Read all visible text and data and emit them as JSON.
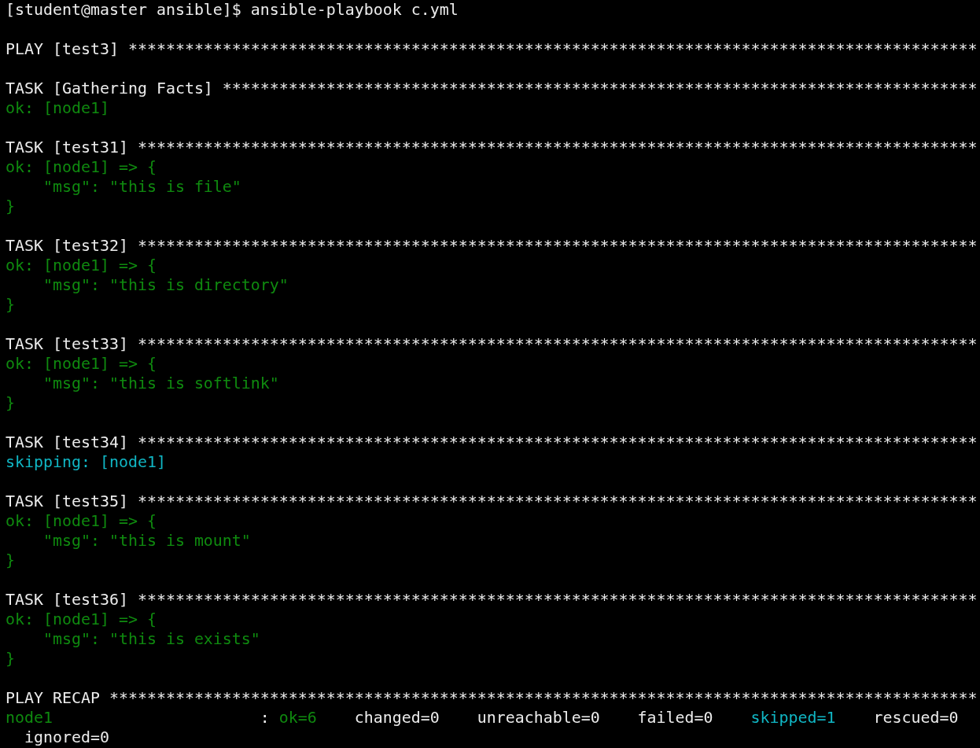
{
  "terminal": {
    "lines": [
      {
        "kind": "text",
        "segments": [
          {
            "kind": "plain",
            "text": "[student@master ansible]$ ansible-playbook c.yml"
          }
        ]
      },
      {
        "kind": "blank"
      },
      {
        "kind": "text",
        "segments": [
          {
            "kind": "plain",
            "text": "PLAY [test3] ******************************************************************************************"
          }
        ]
      },
      {
        "kind": "blank"
      },
      {
        "kind": "text",
        "segments": [
          {
            "kind": "plain",
            "text": "TASK [Gathering Facts] ********************************************************************************"
          }
        ]
      },
      {
        "kind": "text",
        "segments": [
          {
            "kind": "ok",
            "text": "ok: [node1]"
          }
        ]
      },
      {
        "kind": "blank"
      },
      {
        "kind": "text",
        "segments": [
          {
            "kind": "plain",
            "text": "TASK [test31] *****************************************************************************************"
          }
        ]
      },
      {
        "kind": "text",
        "segments": [
          {
            "kind": "ok",
            "text": "ok: [node1] => {"
          }
        ]
      },
      {
        "kind": "text",
        "segments": [
          {
            "kind": "ok",
            "text": "    \"msg\": \"this is file\""
          }
        ]
      },
      {
        "kind": "text",
        "segments": [
          {
            "kind": "ok",
            "text": "}"
          }
        ]
      },
      {
        "kind": "blank"
      },
      {
        "kind": "text",
        "segments": [
          {
            "kind": "plain",
            "text": "TASK [test32] *****************************************************************************************"
          }
        ]
      },
      {
        "kind": "text",
        "segments": [
          {
            "kind": "ok",
            "text": "ok: [node1] => {"
          }
        ]
      },
      {
        "kind": "text",
        "segments": [
          {
            "kind": "ok",
            "text": "    \"msg\": \"this is directory\""
          }
        ]
      },
      {
        "kind": "text",
        "segments": [
          {
            "kind": "ok",
            "text": "}"
          }
        ]
      },
      {
        "kind": "blank"
      },
      {
        "kind": "text",
        "segments": [
          {
            "kind": "plain",
            "text": "TASK [test33] *****************************************************************************************"
          }
        ]
      },
      {
        "kind": "text",
        "segments": [
          {
            "kind": "ok",
            "text": "ok: [node1] => {"
          }
        ]
      },
      {
        "kind": "text",
        "segments": [
          {
            "kind": "ok",
            "text": "    \"msg\": \"this is softlink\""
          }
        ]
      },
      {
        "kind": "text",
        "segments": [
          {
            "kind": "ok",
            "text": "}"
          }
        ]
      },
      {
        "kind": "blank"
      },
      {
        "kind": "text",
        "segments": [
          {
            "kind": "plain",
            "text": "TASK [test34] *****************************************************************************************"
          }
        ]
      },
      {
        "kind": "text",
        "segments": [
          {
            "kind": "skipped",
            "text": "skipping: [node1]"
          }
        ]
      },
      {
        "kind": "blank"
      },
      {
        "kind": "text",
        "segments": [
          {
            "kind": "plain",
            "text": "TASK [test35] *****************************************************************************************"
          }
        ]
      },
      {
        "kind": "text",
        "segments": [
          {
            "kind": "ok",
            "text": "ok: [node1] => {"
          }
        ]
      },
      {
        "kind": "text",
        "segments": [
          {
            "kind": "ok",
            "text": "    \"msg\": \"this is mount\""
          }
        ]
      },
      {
        "kind": "text",
        "segments": [
          {
            "kind": "ok",
            "text": "}"
          }
        ]
      },
      {
        "kind": "blank"
      },
      {
        "kind": "text",
        "segments": [
          {
            "kind": "plain",
            "text": "TASK [test36] *****************************************************************************************"
          }
        ]
      },
      {
        "kind": "text",
        "segments": [
          {
            "kind": "ok",
            "text": "ok: [node1] => {"
          }
        ]
      },
      {
        "kind": "text",
        "segments": [
          {
            "kind": "ok",
            "text": "    \"msg\": \"this is exists\""
          }
        ]
      },
      {
        "kind": "text",
        "segments": [
          {
            "kind": "ok",
            "text": "}"
          }
        ]
      },
      {
        "kind": "blank"
      },
      {
        "kind": "text",
        "segments": [
          {
            "kind": "plain",
            "text": "PLAY RECAP ********************************************************************************************"
          }
        ]
      },
      {
        "kind": "text",
        "segments": [
          {
            "kind": "ok",
            "text": "node1"
          },
          {
            "kind": "plain",
            "text": "                      : "
          },
          {
            "kind": "ok",
            "text": "ok=6"
          },
          {
            "kind": "plain",
            "text": "    changed=0    unreachable=0    failed=0    "
          },
          {
            "kind": "skipped",
            "text": "skipped=1"
          },
          {
            "kind": "plain",
            "text": "    rescued=0"
          }
        ]
      },
      {
        "kind": "text",
        "segments": [
          {
            "kind": "plain",
            "text": "  ignored=0"
          }
        ]
      }
    ]
  }
}
